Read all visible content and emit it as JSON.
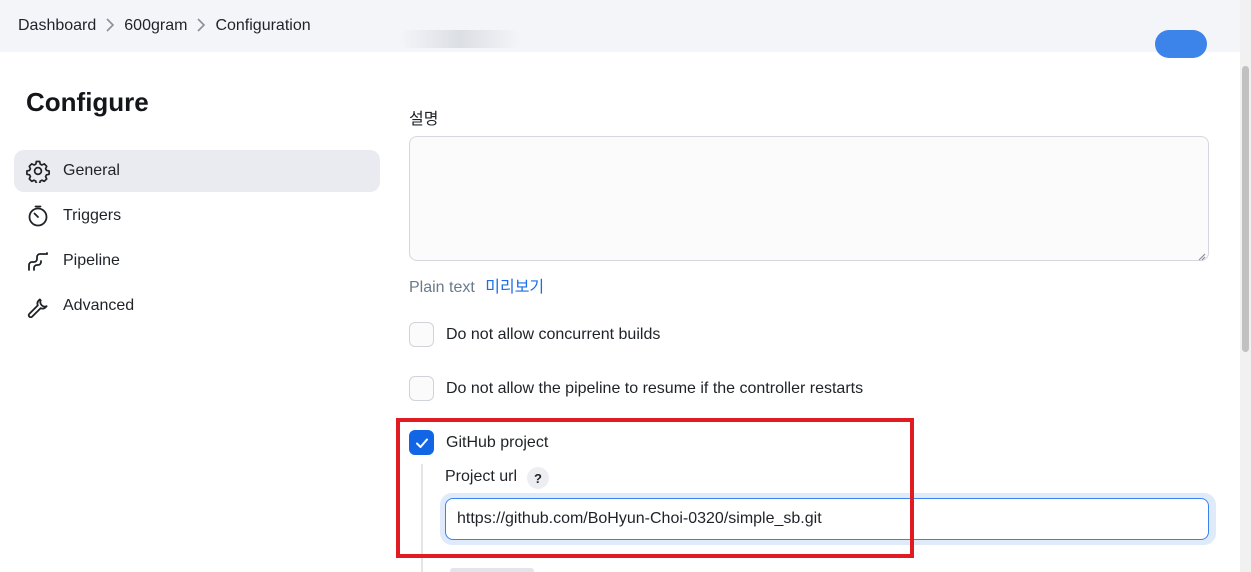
{
  "breadcrumb": {
    "items": [
      "Dashboard",
      "600gram",
      "Configuration"
    ]
  },
  "page": {
    "title": "Configure"
  },
  "sidebar": {
    "items": [
      {
        "label": "General",
        "icon": "gear-icon",
        "active": true
      },
      {
        "label": "Triggers",
        "icon": "timer-icon",
        "active": false
      },
      {
        "label": "Pipeline",
        "icon": "pipeline-icon",
        "active": false
      },
      {
        "label": "Advanced",
        "icon": "wrench-icon",
        "active": false
      }
    ]
  },
  "description": {
    "label": "설명",
    "value": "",
    "format_plain": "Plain text",
    "format_preview": "미리보기"
  },
  "options": {
    "concurrent": {
      "label": "Do not allow concurrent builds",
      "checked": false
    },
    "resume": {
      "label": "Do not allow the pipeline to resume if the controller restarts",
      "checked": false
    },
    "github": {
      "label": "GitHub project",
      "checked": true
    }
  },
  "github_project": {
    "url_label": "Project url",
    "help": "?",
    "url_value": "https://github.com/BoHyun-Choi-0320/simple_sb.git"
  },
  "colors": {
    "accent": "#1266e6",
    "highlight": "#e01b22",
    "active_nav": "#e9ebf0"
  }
}
